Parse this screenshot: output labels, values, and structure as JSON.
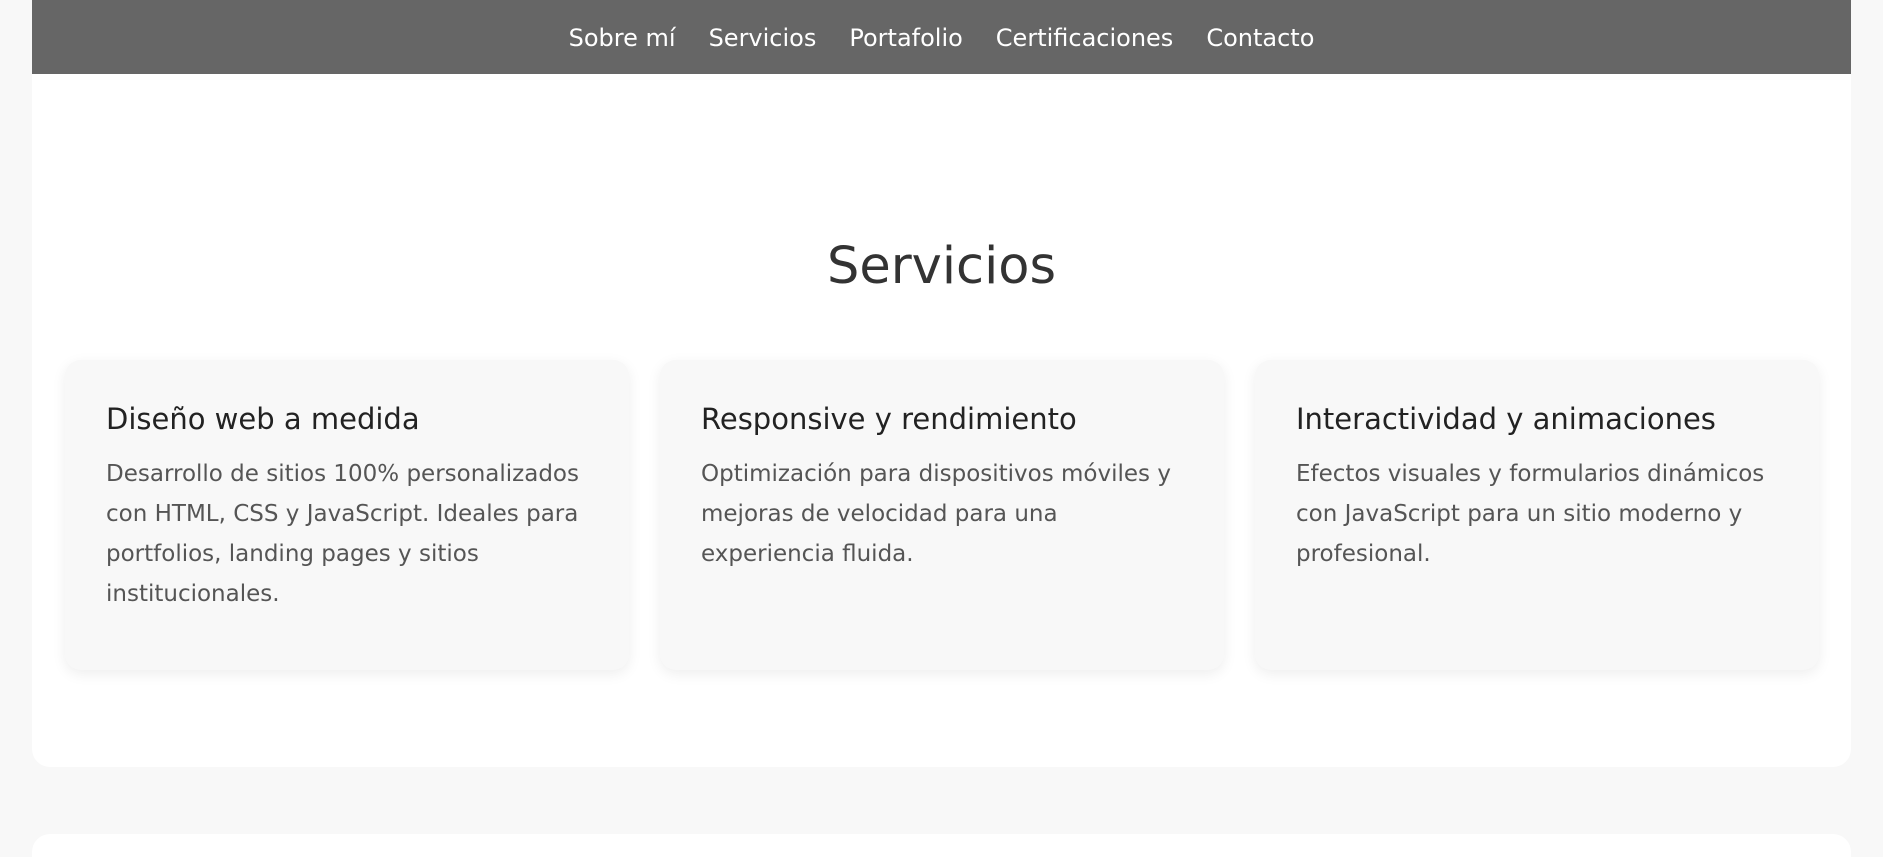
{
  "nav": {
    "items": [
      {
        "label": "Sobre mí"
      },
      {
        "label": "Servicios"
      },
      {
        "label": "Portafolio"
      },
      {
        "label": "Certificaciones"
      },
      {
        "label": "Contacto"
      }
    ]
  },
  "services": {
    "title": "Servicios",
    "cards": [
      {
        "title": "Diseño web a medida",
        "description": "Desarrollo de sitios 100% personalizados con HTML, CSS y JavaScript. Ideales para portfolios, landing pages y sitios institucionales."
      },
      {
        "title": "Responsive y rendimiento",
        "description": "Optimización para dispositivos móviles y mejoras de velocidad para una experiencia fluida."
      },
      {
        "title": "Interactividad y animaciones",
        "description": "Efectos visuales y formularios dinámicos con JavaScript para un sitio moderno y profesional."
      }
    ]
  },
  "colors": {
    "nav_background": "#666666",
    "page_background": "#f8f8f8",
    "card_background": "#f8f8f8",
    "text": "#333333"
  }
}
